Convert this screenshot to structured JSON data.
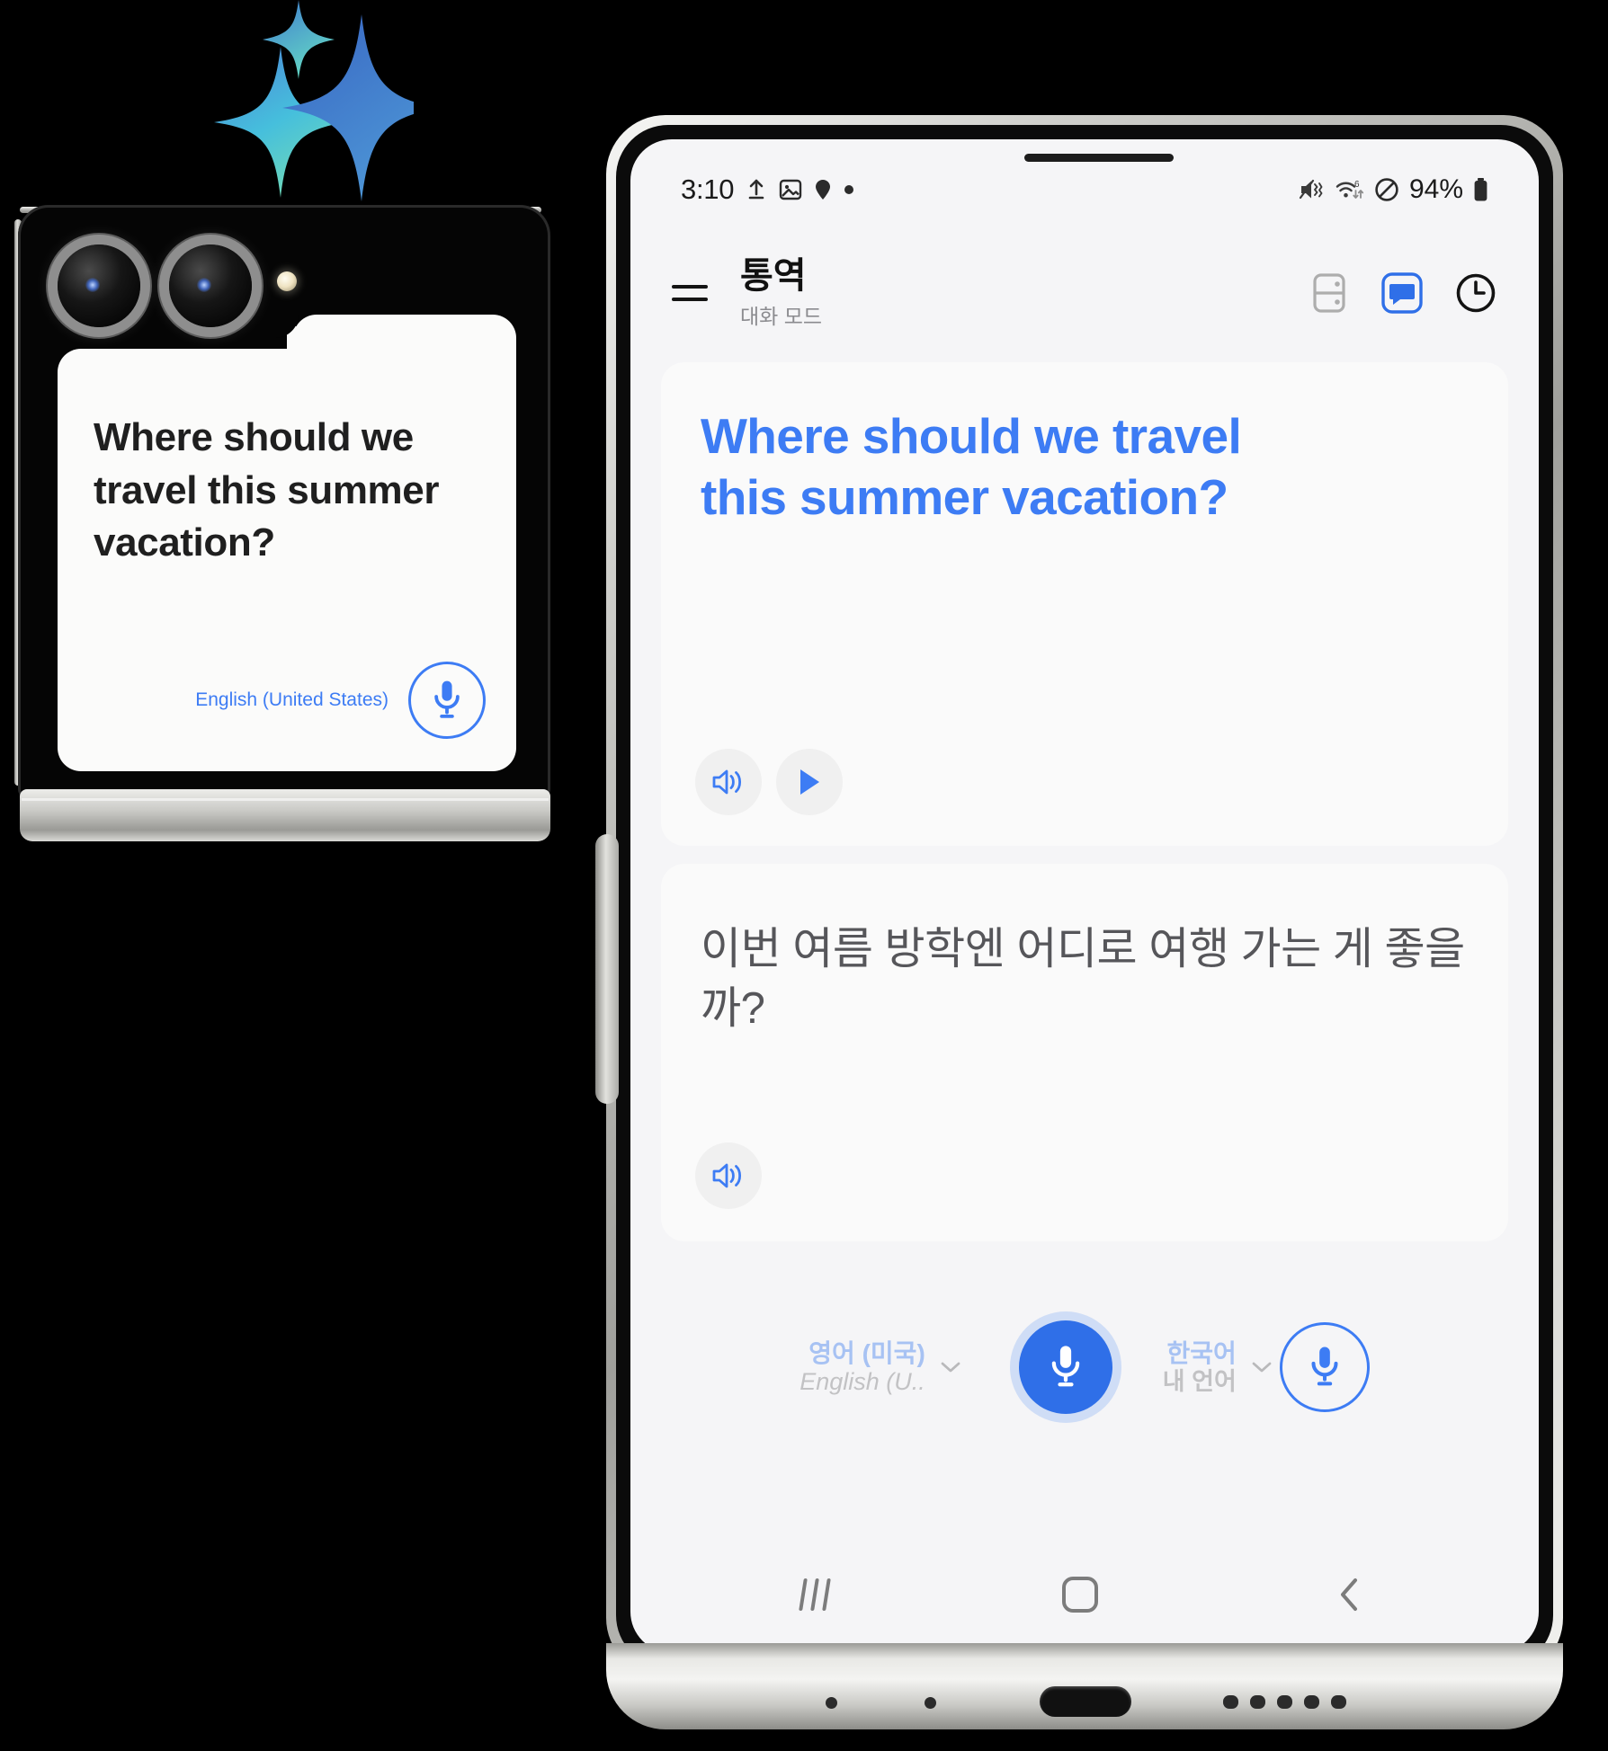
{
  "brand": {
    "ai_sparkle_icon": "galaxy-ai-sparkle",
    "gradient_from": "#3b6fd4",
    "gradient_to": "#5fd3c4"
  },
  "cover_screen": {
    "card_text": "Where should we travel this summer vacation?",
    "language_label": "English (United States)",
    "mic_icon": "microphone-icon",
    "text_color": "#1f1f1f",
    "accent_color": "#3d7cf4"
  },
  "main_screen": {
    "status_bar": {
      "time": "3:10",
      "icons_left": [
        "upload-icon",
        "image-icon",
        "location-pin-icon",
        "dot-icon"
      ],
      "icons_right": [
        "mute-vibrate-icon",
        "wifi-6-icon",
        "do-not-disturb-icon"
      ],
      "battery_percent": "94%",
      "battery_icon": "battery-icon"
    },
    "header": {
      "menu_icon": "hamburger-menu-icon",
      "title": "통역",
      "subtitle": "대화 모드",
      "actions": [
        {
          "name": "split-view-mode-icon",
          "label": "화면 분할 모드",
          "active": false
        },
        {
          "name": "conversation-mode-icon",
          "label": "대화 모드",
          "active": true
        },
        {
          "name": "history-clock-icon",
          "label": "기록",
          "active": false
        }
      ]
    },
    "source_card": {
      "text": "Where should we travel this summer vacation?",
      "text_color": "#3d7cf4",
      "speaker_icon": "speaker-icon",
      "play_icon": "play-icon"
    },
    "target_card": {
      "text": "이번 여름 방학엔 어디로 여행 가는 게 좋을까?",
      "text_color": "#56565a",
      "speaker_icon": "speaker-icon"
    },
    "controls": {
      "left": {
        "primary": "영어 (미국)",
        "secondary": "English (U..",
        "chevron_icon": "chevron-down-icon",
        "mic_icon": "microphone-icon",
        "mic_state": "active"
      },
      "right": {
        "primary": "한국어",
        "secondary": "내 언어",
        "chevron_icon": "chevron-down-icon",
        "mic_icon": "microphone-icon",
        "mic_state": "inactive"
      }
    },
    "nav_bar": {
      "recents_icon": "recents-icon",
      "home_icon": "home-icon",
      "back_icon": "back-chevron-icon"
    }
  }
}
